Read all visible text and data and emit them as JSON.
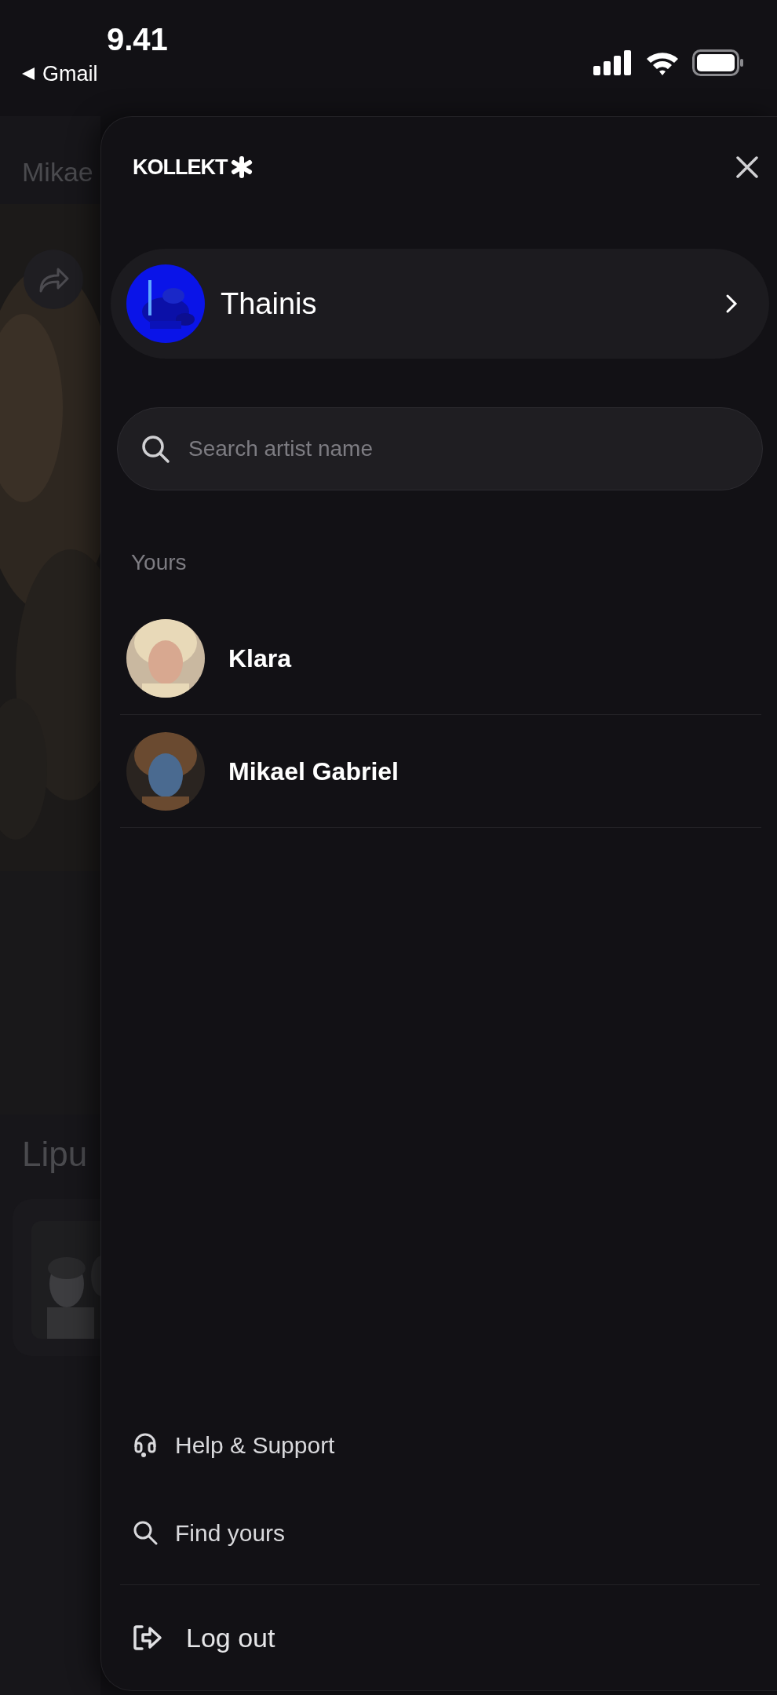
{
  "status_bar": {
    "time": "9.41",
    "back_link": "Gmail"
  },
  "background": {
    "title": "Mikae",
    "section_title": "Lipu"
  },
  "drawer": {
    "logo": "KOLLEKT",
    "profile": {
      "name": "Thainis"
    },
    "search": {
      "placeholder": "Search artist name"
    },
    "section_label": "Yours",
    "artists": [
      {
        "name": "Klara"
      },
      {
        "name": "Mikael Gabriel"
      }
    ],
    "menu": [
      {
        "kind": "help",
        "label": "Help & Support"
      },
      {
        "kind": "search",
        "label": "Find yours"
      }
    ],
    "logout": {
      "label": "Log out"
    }
  }
}
